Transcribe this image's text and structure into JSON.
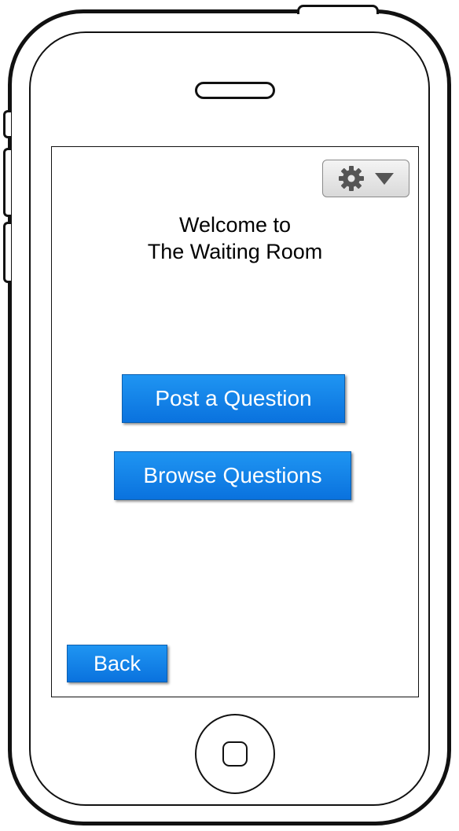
{
  "screen": {
    "welcome_line1": "Welcome to",
    "welcome_line2": "The Waiting Room",
    "post_button_label": "Post a Question",
    "browse_button_label": "Browse Questions",
    "back_button_label": "Back"
  },
  "settings_menu": {
    "icon": "gear-icon",
    "dropdown_icon": "chevron-down-icon"
  },
  "colors": {
    "button_blue": "#1a85ea",
    "button_text": "#ffffff",
    "outline": "#111111"
  }
}
